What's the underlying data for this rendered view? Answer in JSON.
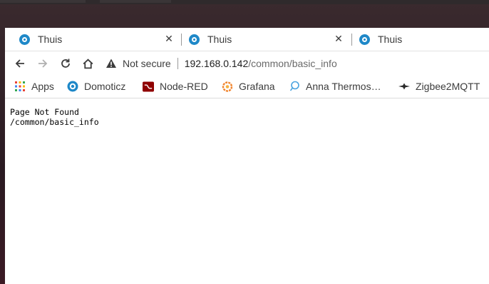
{
  "tabs": [
    {
      "title": "Thuis",
      "close": "✕"
    },
    {
      "title": "Thuis",
      "close": "✕"
    },
    {
      "title": "Thuis"
    }
  ],
  "toolbar": {
    "security_label": "Not secure",
    "url_host": "192.168.0.142",
    "url_path": "/common/basic_info"
  },
  "bookmarks": [
    {
      "label": "Apps",
      "icon": "apps-grid-icon"
    },
    {
      "label": "Domoticz",
      "icon": "domoticz-icon"
    },
    {
      "label": "Node-RED",
      "icon": "node-red-icon"
    },
    {
      "label": "Grafana",
      "icon": "grafana-icon"
    },
    {
      "label": "Anna Thermos…",
      "icon": "anna-thermostat-icon"
    },
    {
      "label": "Zigbee2MQTT",
      "icon": "zigbee2mqtt-icon"
    }
  ],
  "page": {
    "line1": "Page Not Found",
    "line2": "/common/basic_info"
  },
  "colors": {
    "favicon_blue": "#1e88c8",
    "node_red": "#8f0000",
    "grafana_orange": "#f0822a"
  }
}
